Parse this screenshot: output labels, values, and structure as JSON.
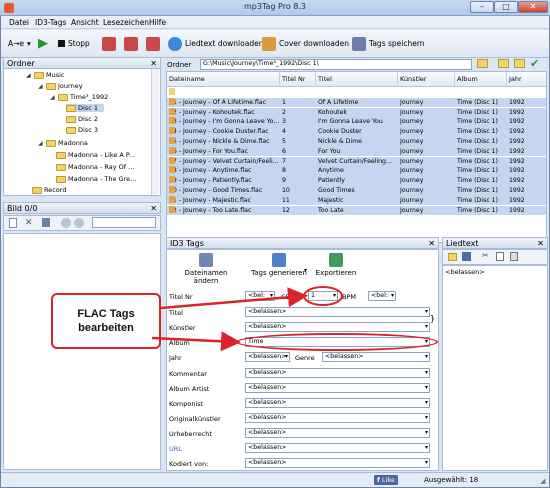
{
  "window": {
    "title": "mp3Tag Pro 8.3",
    "min": "–",
    "max": "□",
    "close": "✕"
  },
  "menu": [
    "Datei",
    "ID3-Tags",
    "Ansicht",
    "Lesezeichen",
    "Hilfe"
  ],
  "toolbar": {
    "mode": "A→e",
    "stop": "Stopp",
    "lyrics": "Liedtext downloaden",
    "cover": "Cover downloaden",
    "save": "Tags speichern"
  },
  "folder_panel": {
    "title": "Ordner",
    "close": "✕"
  },
  "tree": [
    {
      "label": "Music",
      "level": 0,
      "open": true
    },
    {
      "label": "Journey",
      "level": 1,
      "open": true
    },
    {
      "label": "Time³_1992",
      "level": 2,
      "open": true
    },
    {
      "label": "Disc 1",
      "level": 3,
      "selected": true
    },
    {
      "label": "Disc 2",
      "level": 3
    },
    {
      "label": "Disc 3",
      "level": 3
    },
    {
      "label": "Madonna",
      "level": 1,
      "open": true
    },
    {
      "label": "Madonna - Like A P...",
      "level": 2
    },
    {
      "label": "Madonna - Ray Of ...",
      "level": 2
    },
    {
      "label": "Madonna - The Gre...",
      "level": 2
    },
    {
      "label": "Record",
      "level": 0
    }
  ],
  "bild_panel": {
    "title": "Bild 0/0",
    "close": "✕"
  },
  "path_bar": {
    "label": "Ordner",
    "value": "G:\\Music\\Journey\\Time³_1992\\Disc 1\\"
  },
  "file_columns": [
    "Dateiname",
    "Titel Nr",
    "Titel",
    "Künstler",
    "Album",
    "Jahr"
  ],
  "files": [
    {
      "name": "..",
      "nr": "",
      "title": "",
      "artist": "",
      "album": "",
      "year": ""
    },
    {
      "name": "01 - Journey - Of A Lifetime.flac",
      "nr": "1",
      "title": "Of A Lifetime",
      "artist": "Journey",
      "album": "Time (Disc 1)",
      "year": "1992"
    },
    {
      "name": "02 - Journey - Kohoutek.flac",
      "nr": "2",
      "title": "Kohoutek",
      "artist": "Journey",
      "album": "Time (Disc 1)",
      "year": "1992"
    },
    {
      "name": "03 - Journey - I'm Gonna Leave Yo...",
      "nr": "3",
      "title": "I'm Gonna Leave You",
      "artist": "Journey",
      "album": "Time (Disc 1)",
      "year": "1992"
    },
    {
      "name": "04 - Journey - Cookie Duster.flac",
      "nr": "4",
      "title": "Cookie Duster",
      "artist": "Journey",
      "album": "Time (Disc 1)",
      "year": "1992"
    },
    {
      "name": "05 - Journey - Nickle & Dime.flac",
      "nr": "5",
      "title": "Nickle & Dime",
      "artist": "Journey",
      "album": "Time (Disc 1)",
      "year": "1992"
    },
    {
      "name": "06 - Journey - For You.flac",
      "nr": "6",
      "title": "For You",
      "artist": "Journey",
      "album": "Time (Disc 1)",
      "year": "1992"
    },
    {
      "name": "07 - Journey - Velvet Curtain/Feeli...",
      "nr": "7",
      "title": "Velvet Curtain/Feeling...",
      "artist": "Journey",
      "album": "Time (Disc 1)",
      "year": "1992"
    },
    {
      "name": "08 - Journey - Anytime.flac",
      "nr": "8",
      "title": "Anytime",
      "artist": "Journey",
      "album": "Time (Disc 1)",
      "year": "1992"
    },
    {
      "name": "09 - Journey - Patiently.flac",
      "nr": "9",
      "title": "Patiently",
      "artist": "Journey",
      "album": "Time (Disc 1)",
      "year": "1992"
    },
    {
      "name": "10 - Journey - Good Times.flac",
      "nr": "10",
      "title": "Good Times",
      "artist": "Journey",
      "album": "Time (Disc 1)",
      "year": "1992"
    },
    {
      "name": "11 - Journey - Majestic.flac",
      "nr": "11",
      "title": "Majestic",
      "artist": "Journey",
      "album": "Time (Disc 1)",
      "year": "1992"
    },
    {
      "name": "12 - Journey - Too Late.flac",
      "nr": "12",
      "title": "Too Late",
      "artist": "Journey",
      "album": "Time (Disc 1)",
      "year": "1992"
    }
  ],
  "id3_panel": {
    "title": "ID3 Tags",
    "close": "✕",
    "rename": "Dateinamen ändern",
    "generate": "Tags generieren",
    "export": "Exportieren"
  },
  "fields": {
    "titelnr_label": "Titel Nr",
    "titelnr_val": "<bel:",
    "cd_label": "CD",
    "cd_val": "1",
    "bpm_label": "BPM",
    "bpm_val": "<bel:",
    "titel_label": "Titel",
    "titel_val": "<belassen>",
    "kuenstler_label": "Künstler",
    "kuenstler_val": "<belassen>",
    "album_label": "Album",
    "album_val": "Time",
    "jahr_label": "Jahr",
    "jahr_val": "<belassen>",
    "genre_label": "Genre",
    "genre_val": "<belassen>",
    "kommentar_label": "Kommentar",
    "kommentar_val": "<belassen>",
    "albumartist_label": "Album Artist",
    "albumartist_val": "<belassen>",
    "komponist_label": "Komponist",
    "komponist_val": "<belassen>",
    "original_label": "Originalkünstler",
    "original_val": "<belassen>",
    "urheber_label": "Urheberrecht",
    "urheber_val": "<belassen>",
    "url_label": "URL",
    "url_val": "<belassen>",
    "kodiert_label": "Kodiert von:",
    "kodiert_val": "<belassen>"
  },
  "lyrics_panel": {
    "title": "Liedtext",
    "close": "✕",
    "value": "<belassen>"
  },
  "callout": {
    "line1": "FLAC Tags",
    "line2": "bearbeiten"
  },
  "status": {
    "like": "Like",
    "count": "Ausgewählt: 18"
  },
  "colors": {
    "accent_red": "#d9252a",
    "selection": "#c5d7f0",
    "folder": "#f2d36b"
  }
}
